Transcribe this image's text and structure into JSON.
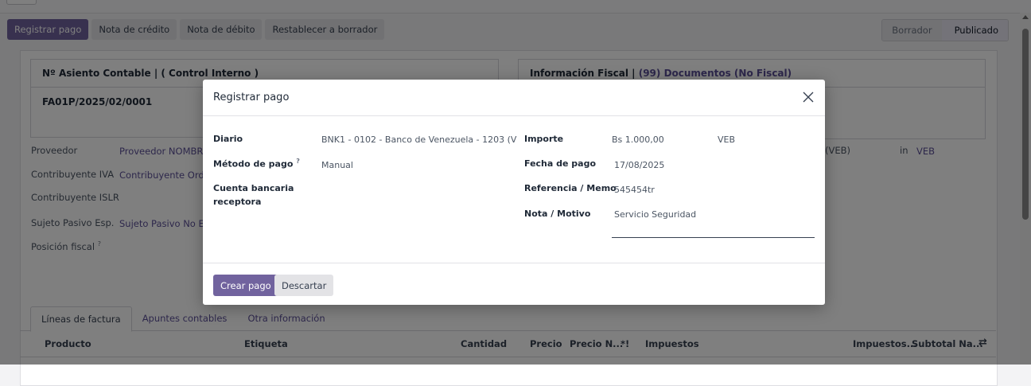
{
  "toolbar": {
    "register_payment": "Registrar pago",
    "credit_note": "Nota de crédito",
    "debit_note": "Nota de débito",
    "reset_draft": "Restablecer a borrador"
  },
  "status": {
    "draft": "Borrador",
    "posted": "Publicado"
  },
  "left_card": {
    "title": "Nº Asiento Contable | ( Control Interno )",
    "value": "FA01P/2025/02/0001"
  },
  "right_card": {
    "title_prefix": "Información Fiscal |",
    "title_link": "(99) Documentos (No Fiscal)"
  },
  "form": {
    "supplier_label": "Proveedor",
    "supplier_value": "Proveedor NOMBRE",
    "iva_label": "Contribuyente IVA",
    "iva_value": "Contribuyente Ordin",
    "islr_label": "Contribuyente ISLR",
    "sujeto_label": "Sujeto Pasivo Esp.",
    "sujeto_value": "Sujeto Pasivo No Esp",
    "fiscal_position_label": "Posición fiscal",
    "right_currency_label": "(VEB)",
    "right_in": "in",
    "right_currency_value": "VEB"
  },
  "tabs": {
    "lines": "Líneas de factura",
    "entries": "Apuntes contables",
    "other": "Otra información"
  },
  "table_headers": {
    "product": "Producto",
    "label": "Etiqueta",
    "quantity": "Cantidad",
    "price": "Precio",
    "net_price": "Precio N...",
    "flag": "*!",
    "taxes": "Impuestos",
    "taxes2": "Impuestos...",
    "subtotal": "Subtotal Na..."
  },
  "modal": {
    "title": "Registrar pago",
    "journal_label": "Diario",
    "journal_value": "BNK1 - 0102 - Banco de Venezuela - 1203 (V",
    "method_label": "Método de pago",
    "method_value": "Manual",
    "bank_label_1": "Cuenta bancaria",
    "bank_label_2": "receptora",
    "amount_label": "Importe",
    "amount_value": "Bs 1.000,00",
    "currency_value": "VEB",
    "date_label": "Fecha de pago",
    "date_value": "17/08/2025",
    "memo_label": "Referencia / Memo",
    "memo_value": "545454tr",
    "note_label": "Nota / Motivo",
    "note_value": "Servicio Seguridad",
    "create_button": "Crear pago",
    "discard_button": "Descartar"
  },
  "colors": {
    "primary": "#71639e",
    "link": "#5b4f97"
  }
}
